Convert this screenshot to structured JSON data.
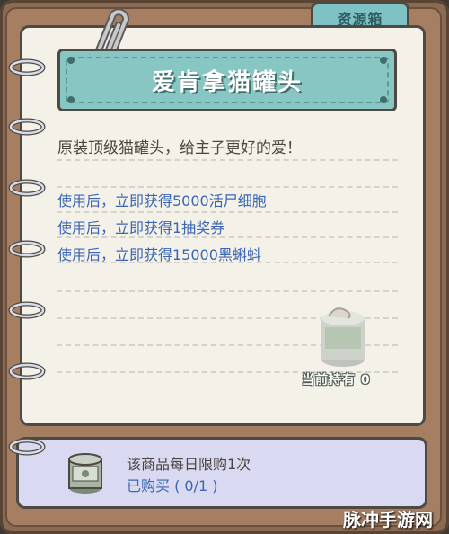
{
  "tab": {
    "label": "资源箱"
  },
  "item": {
    "name": "爱肯拿猫罐头",
    "description": "原装顶级猫罐头，给主子更好的爱！",
    "effects": [
      "使用后，立即获得5000活尸细胞",
      "使用后，立即获得1抽奖券",
      "使用后，立即获得15000黑蝌蚪"
    ],
    "owned_label": "当前持有 0"
  },
  "purchase": {
    "limit_text": "该商品每日限购1次",
    "bought_text": "已购买 ( 0/1 )"
  },
  "watermark": "脉冲手游网",
  "colors": {
    "teal": "#87c6c2",
    "paper": "#f4f1e8",
    "effect_text": "#3a66b4",
    "card_bg": "#d9daf2",
    "leather": "#a67f63"
  },
  "icons": [
    "ring-binder-icon",
    "paperclip-icon",
    "cat-food-can-icon"
  ]
}
